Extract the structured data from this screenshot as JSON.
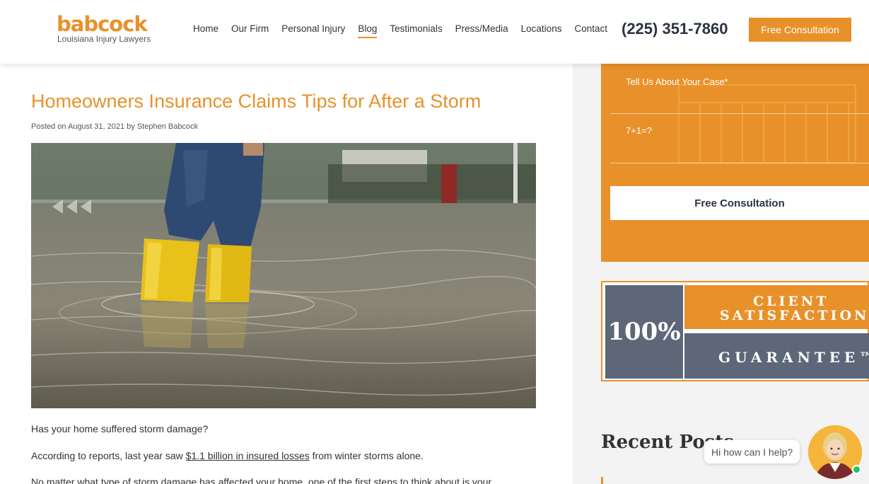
{
  "header": {
    "logo": {
      "name": "babcock",
      "tagline": "Louisiana Injury Lawyers"
    },
    "nav": [
      "Home",
      "Our Firm",
      "Personal Injury",
      "Blog",
      "Testimonials",
      "Press/Media",
      "Locations",
      "Contact"
    ],
    "active_nav": "Blog",
    "phone": "(225) 351-7860",
    "cta_label": "Free Consultation"
  },
  "post": {
    "title": "Homeowners Insurance Claims Tips for After a Storm",
    "meta": "Posted on August 31, 2021 by Stephen Babcock",
    "paragraph1": "Has your home suffered storm damage?",
    "paragraph2_prefix": "According to reports, last year saw ",
    "paragraph2_link": "$1.1 billion in insured losses",
    "paragraph2_suffix": " from winter storms alone.",
    "paragraph3": "No matter what type of storm damage has affected your home, one of the first steps to think about is your"
  },
  "sidebar": {
    "form": {
      "case_label": "Tell Us About Your Case*",
      "captcha_label": "7+1=?",
      "submit_label": "Free Consultation"
    },
    "guarantee": {
      "percent": "100%",
      "line1": "CLIENT",
      "line2": "SATISFACTION",
      "line3": "GUARANTEE™"
    },
    "recent_posts_title": "Recent Posts"
  },
  "chat": {
    "greeting": "Hi how can I help?"
  },
  "colors": {
    "brand_orange": "#e8912a",
    "slate": "#5d6778",
    "dark_text": "#2b3340"
  }
}
